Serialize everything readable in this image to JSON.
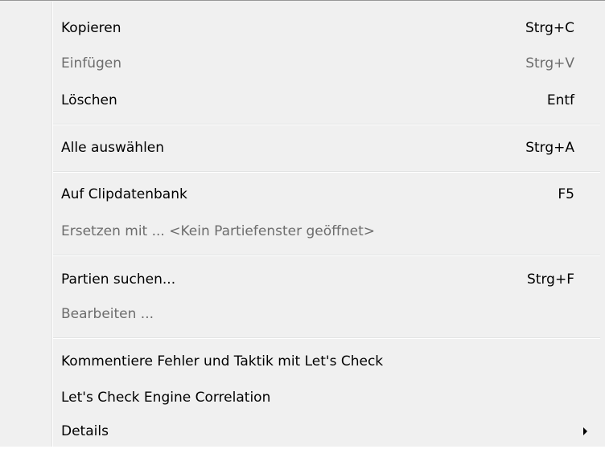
{
  "menu": {
    "items": [
      {
        "label": "Kopieren",
        "shortcut": "Strg+C",
        "enabled": true
      },
      {
        "label": "Einfügen",
        "shortcut": "Strg+V",
        "enabled": false
      },
      {
        "label": "Löschen",
        "shortcut": "Entf",
        "enabled": true
      },
      {
        "label": "Alle auswählen",
        "shortcut": "Strg+A",
        "enabled": true
      },
      {
        "label": "Auf Clipdatenbank",
        "shortcut": "F5",
        "enabled": true
      },
      {
        "label": "Ersetzen mit ... <Kein Partiefenster geöffnet>",
        "shortcut": "",
        "enabled": false
      },
      {
        "label": "Partien suchen...",
        "shortcut": "Strg+F",
        "enabled": true
      },
      {
        "label": "Bearbeiten ...",
        "shortcut": "",
        "enabled": false
      },
      {
        "label": "Kommentiere Fehler und Taktik mit Let's Check",
        "shortcut": "",
        "enabled": true
      },
      {
        "label": "Let's Check Engine Correlation",
        "shortcut": "",
        "enabled": true
      },
      {
        "label": "Details",
        "shortcut": "",
        "enabled": true,
        "submenu": true
      }
    ]
  },
  "colors": {
    "menu_background": "#f0f0f0",
    "menu_border": "#979797",
    "text": "#000000",
    "disabled_text": "#6d6d6d",
    "separator_dark": "#e2e3e3",
    "separator_light": "#ffffff"
  },
  "icons": {
    "submenu_arrow": "triangle-right"
  }
}
